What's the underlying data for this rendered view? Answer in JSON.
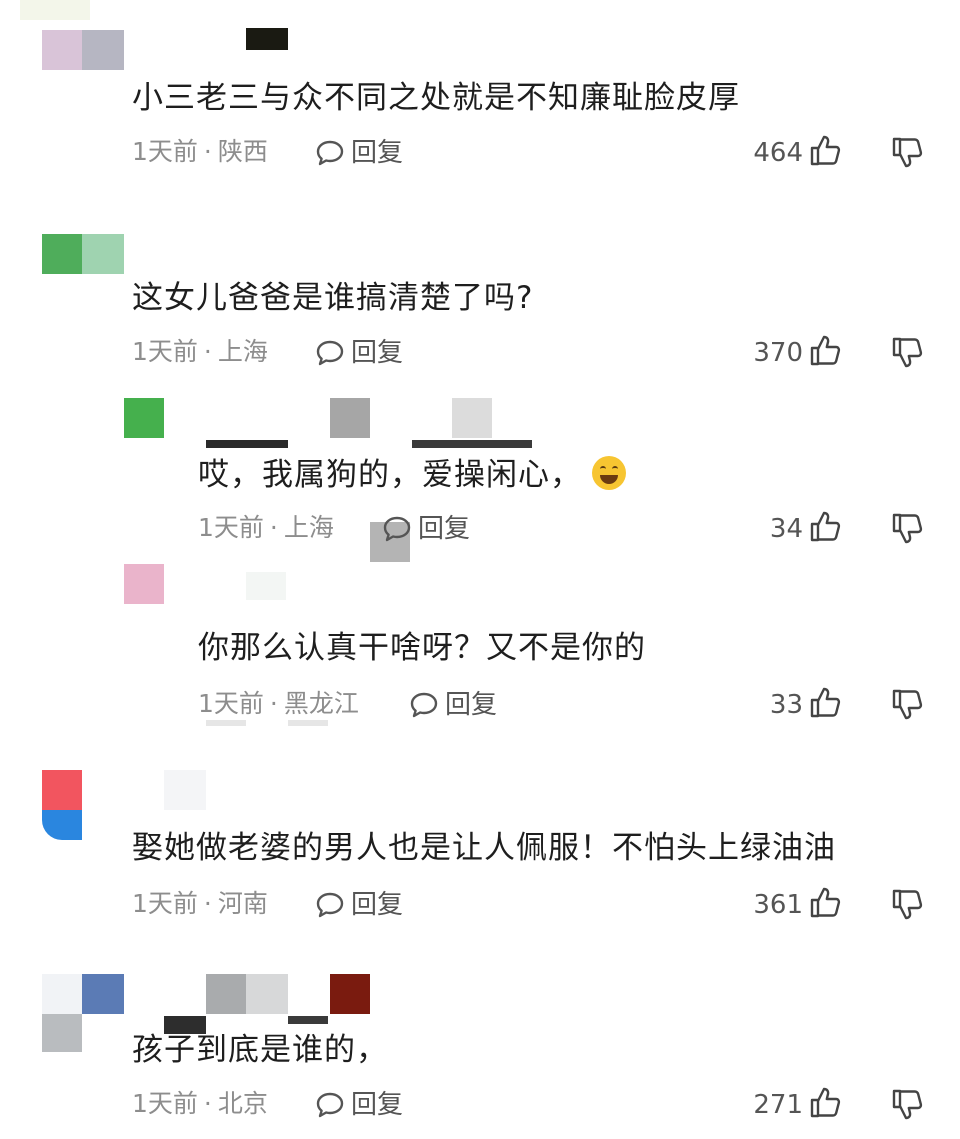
{
  "comments": [
    {
      "text": "小三老三与众不同之处就是不知廉耻脸皮厚",
      "time": "1天前",
      "location": "陕西",
      "reply_label": "回复",
      "likes": "464",
      "avatar_colors": [
        "#d9c4d8",
        "#b6b6c2"
      ]
    },
    {
      "text": "这女儿爸爸是谁搞清楚了吗?",
      "time": "1天前",
      "location": "上海",
      "reply_label": "回复",
      "likes": "370",
      "avatar_colors": [
        "#4fad5b",
        "#9fd3b0"
      ]
    },
    {
      "text": "哎，我属狗的，爱操闲心，",
      "time": "1天前",
      "location": "上海",
      "reply_label": "回复",
      "likes": "34",
      "avatar_colors": [
        "#45b04d"
      ]
    },
    {
      "text": "你那么认真干啥呀？又不是你的",
      "time": "1天前",
      "location": "黑龙江",
      "reply_label": "回复",
      "likes": "33",
      "avatar_colors": [
        "#eab4cb"
      ]
    },
    {
      "text": "娶她做老婆的男人也是让人佩服！不怕头上绿油油",
      "time": "1天前",
      "location": "河南",
      "reply_label": "回复",
      "likes": "361",
      "avatar_colors": [
        "#f2555f",
        "#2a86df"
      ]
    },
    {
      "text": "孩子到底是谁的，",
      "time": "1天前",
      "location": "北京",
      "reply_label": "回复",
      "likes": "271",
      "avatar_colors": [
        "#f1f3f6",
        "#5b7bb5"
      ]
    }
  ],
  "meta_separator": "·",
  "icons": {
    "reply": "comment-bubble-icon",
    "like": "thumbs-up-icon",
    "dislike": "thumbs-down-icon",
    "emoji": "grinning-face-emoji"
  },
  "colors": {
    "text": "#1e1e1e",
    "meta": "#8d8d8d",
    "action": "#555555"
  }
}
